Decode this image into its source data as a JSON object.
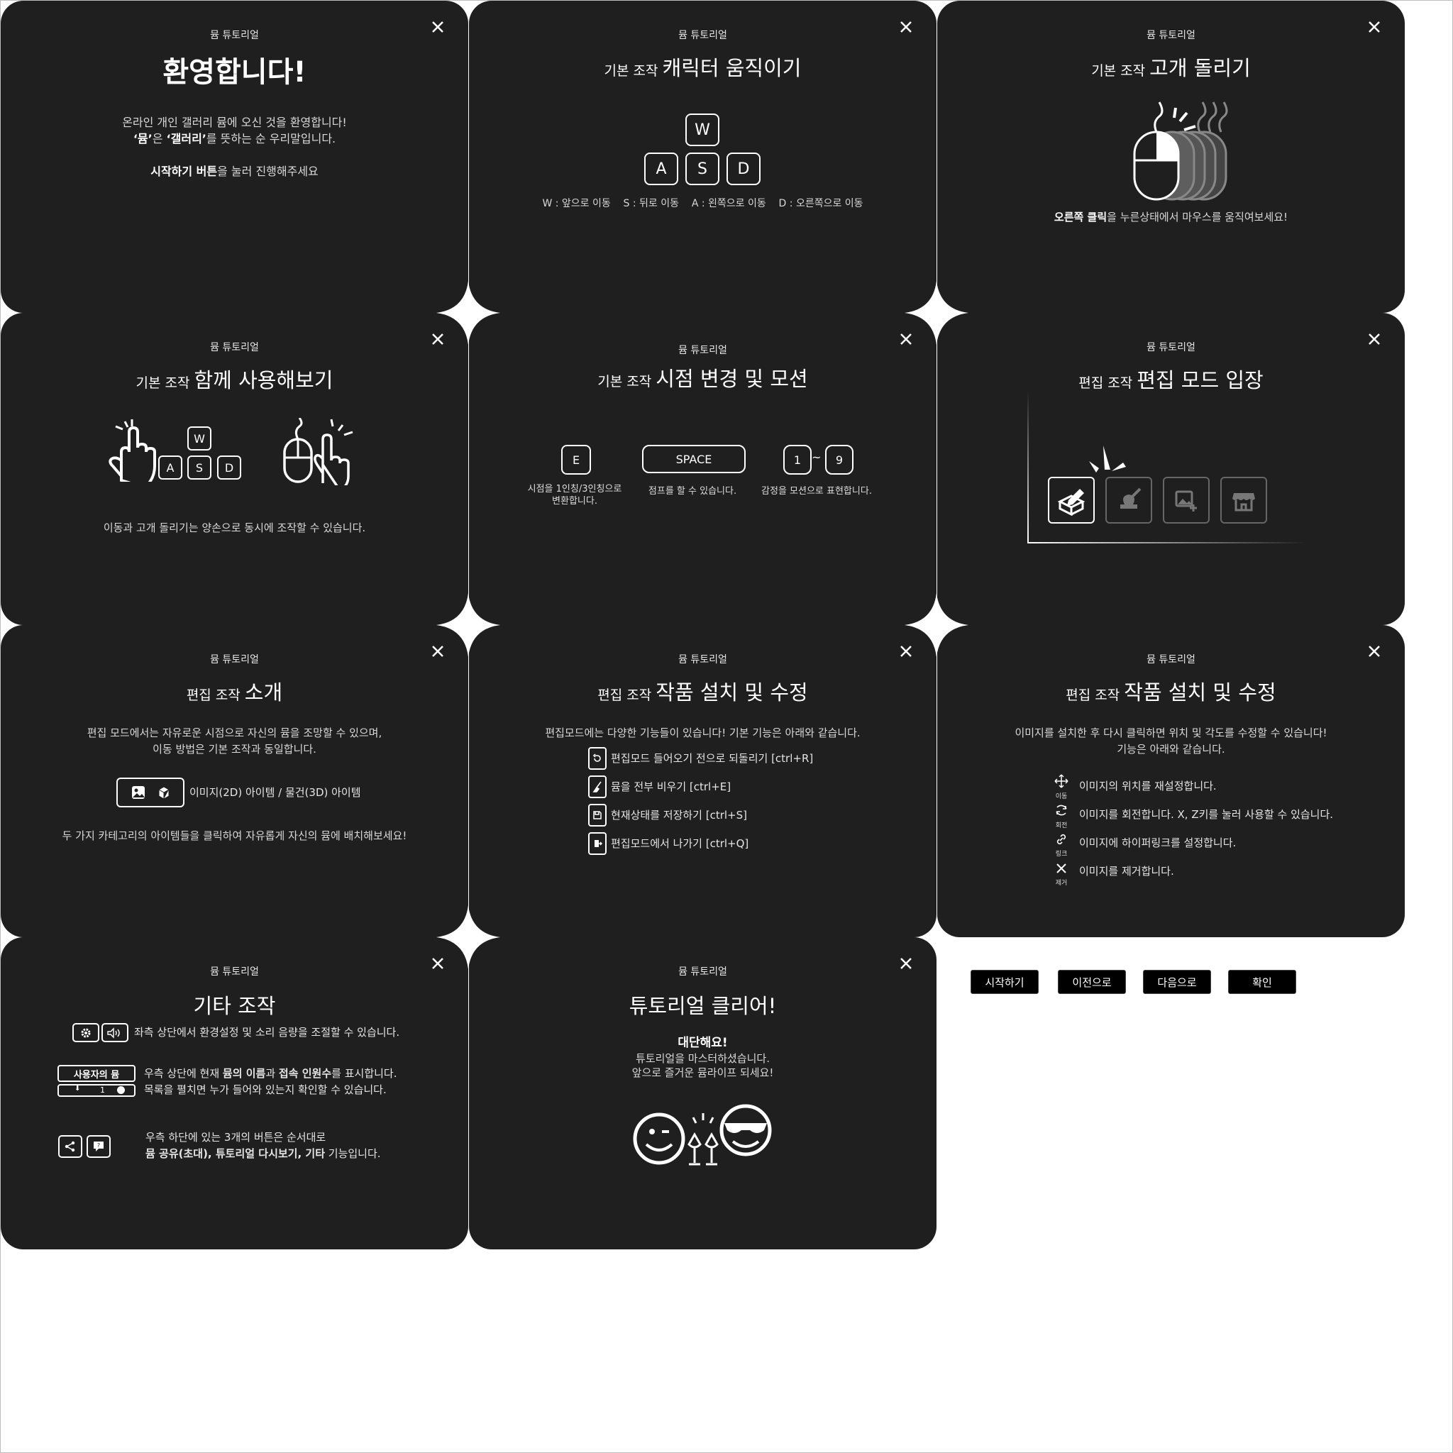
{
  "kicker": "뮴 튜토리얼",
  "c1": {
    "title": "환영합니다!",
    "line1": "온라인 개인 갤러리 뮴에 오신 것을 환영합니다!",
    "line2a": "‘뮴’",
    "line2b": "은 ",
    "line2c": "‘갤러리’",
    "line2d": "를 뜻하는 순 우리말입니다.",
    "line3a": "시작하기 버튼",
    "line3b": "을 눌러 진행해주세요"
  },
  "c2": {
    "small": "기본 조작",
    "big": "캐릭터 움직이기",
    "keys": [
      "W",
      "A",
      "S",
      "D"
    ],
    "caption": "W : 앞으로 이동    S : 뒤로 이동    A : 왼쪽으로 이동    D : 오른쪽으로 이동"
  },
  "c3": {
    "small": "기본 조작",
    "big": "고개 돌리기",
    "cap_b": "오른쪽 클릭",
    "cap_r": "을 누른상태에서 마우스를 움직여보세요!"
  },
  "c4": {
    "small": "기본 조작",
    "big": "함께 사용해보기",
    "keys": [
      "W",
      "A",
      "S",
      "D"
    ],
    "caption": "이동과 고개 돌리기는 양손으로 동시에 조작할 수 있습니다."
  },
  "c5": {
    "small": "기본 조작",
    "big": "시점 변경 및 모션",
    "key_e": "E",
    "key_space": "SPACE",
    "key_1": "1",
    "tilde": "~",
    "key_9": "9",
    "cap1a": "시점을 1인칭/3인칭으로",
    "cap1b": "변환합니다.",
    "cap2": "점프를 할 수 있습니다.",
    "cap3": "감정을 모션으로 표현합니다."
  },
  "c6": {
    "small": "편집 조작",
    "big": "편집 모드 입장"
  },
  "c7": {
    "small": "편집 조작",
    "big": "소개",
    "line1": "편집 모드에서는 자유로운 시점으로 자신의 뮴을 조망할 수 있으며,",
    "line2": "이동 방법은 기본 조작과 동일합니다.",
    "items": "이미지(2D) 아이템 / 물건(3D) 아이템",
    "bottom": "두 가지 카테고리의 아이템들을 클릭하여 자유롭게 자신의 뮴에 배치해보세요!"
  },
  "c8": {
    "small": "편집 조작",
    "big": "작품 설치 및 수정",
    "intro": "편집모드에는 다양한 기능들이 있습니다! 기본 기능은 아래와 같습니다.",
    "list": [
      "편집모드 들어오기 전으로 되돌리기 [ctrl+R]",
      "뮴을 전부 비우기 [ctrl+E]",
      "현재상태를 저장하기 [ctrl+S]",
      "편집모드에서 나가기 [ctrl+Q]"
    ]
  },
  "c9": {
    "small": "편집 조작",
    "big": "작품 설치 및 수정",
    "line1": "이미지를 설치한 후 다시 클릭하면 위치 및 각도를 수정할 수 있습니다!",
    "line2": "기능은 아래와 같습니다.",
    "list": [
      {
        "icon_label": "이동",
        "text": "이미지의 위치를 재설정합니다."
      },
      {
        "icon_label": "회전",
        "text": "이미지를 회전합니다. X, Z키를 눌러 사용할 수 있습니다."
      },
      {
        "icon_label": "링크",
        "text": "이미지에 하이퍼링크를 설정합니다."
      },
      {
        "icon_label": "제거",
        "text": "이미지를 제거합니다."
      }
    ]
  },
  "c10": {
    "big": "기타 조작",
    "line1": "좌측 상단에서 환경설정 및 소리 음량을 조절할 수 있습니다.",
    "badge_title": "사용자의 뮴",
    "badge_count": "1",
    "line2a": "우측 상단에 현재 ",
    "line2b": "뮴의 이름",
    "line2c": "과 ",
    "line2d": "접속 인원수",
    "line2e": "를 표시합니다.",
    "line3": "목록을 펼치면 누가 들어와 있는지 확인할 수 있습니다.",
    "line4": "우측 하단에 있는 3개의 버튼은 순서대로",
    "line5b": "뮴 공유(초대), 튜토리얼 다시보기, 기타",
    "line5r": " 기능입니다."
  },
  "c11": {
    "big": "튜토리얼 클리어!",
    "line1": "대단해요!",
    "line2": "튜토리얼을 마스터하셨습니다.",
    "line3": "앞으로 즐거운 뮴라이프 되세요!"
  },
  "buttons": {
    "start": "시작하기",
    "prev": "이전으로",
    "next": "다음으로",
    "ok": "확인"
  },
  "colors": {
    "card": "#1f1f1f",
    "page": "#ffffff",
    "text": "#ffffff"
  }
}
